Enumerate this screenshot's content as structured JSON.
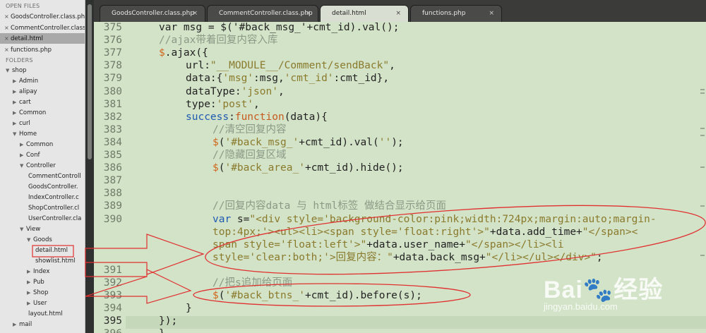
{
  "sidebar": {
    "open_files_heading": "OPEN FILES",
    "open_files": [
      {
        "label": "GoodsController.class.ph",
        "selected": false
      },
      {
        "label": "CommentController.class",
        "selected": false
      },
      {
        "label": "detail.html",
        "selected": true
      },
      {
        "label": "functions.php",
        "selected": false
      }
    ],
    "folders_heading": "FOLDERS",
    "tree": [
      {
        "label": "shop",
        "depth": 0,
        "state": "open"
      },
      {
        "label": "Admin",
        "depth": 1,
        "state": "closed"
      },
      {
        "label": "alipay",
        "depth": 1,
        "state": "closed"
      },
      {
        "label": "cart",
        "depth": 1,
        "state": "closed"
      },
      {
        "label": "Common",
        "depth": 1,
        "state": "closed"
      },
      {
        "label": "curl",
        "depth": 1,
        "state": "closed"
      },
      {
        "label": "Home",
        "depth": 1,
        "state": "open"
      },
      {
        "label": "Common",
        "depth": 2,
        "state": "closed"
      },
      {
        "label": "Conf",
        "depth": 2,
        "state": "closed"
      },
      {
        "label": "Controller",
        "depth": 2,
        "state": "open"
      },
      {
        "label": "CommentControll",
        "depth": 3,
        "state": "file"
      },
      {
        "label": "GoodsController.",
        "depth": 3,
        "state": "file"
      },
      {
        "label": "IndexController.c",
        "depth": 3,
        "state": "file"
      },
      {
        "label": "ShopController.cl",
        "depth": 3,
        "state": "file"
      },
      {
        "label": "UserController.cla",
        "depth": 3,
        "state": "file"
      },
      {
        "label": "View",
        "depth": 2,
        "state": "open"
      },
      {
        "label": "Goods",
        "depth": 3,
        "state": "open"
      },
      {
        "label": "detail.html",
        "depth": 4,
        "state": "file",
        "highlight": true
      },
      {
        "label": "showlist.html",
        "depth": 4,
        "state": "file"
      },
      {
        "label": "Index",
        "depth": 3,
        "state": "closed"
      },
      {
        "label": "Pub",
        "depth": 3,
        "state": "closed"
      },
      {
        "label": "Shop",
        "depth": 3,
        "state": "closed"
      },
      {
        "label": "User",
        "depth": 3,
        "state": "closed"
      },
      {
        "label": "layout.html",
        "depth": 3,
        "state": "file"
      },
      {
        "label": "mail",
        "depth": 1,
        "state": "closed"
      }
    ]
  },
  "tabs": [
    {
      "label": "GoodsController.class.php",
      "active": false
    },
    {
      "label": "CommentController.class.php",
      "active": false
    },
    {
      "label": "detail.html",
      "active": true
    },
    {
      "label": "functions.php",
      "active": false
    }
  ],
  "editor": {
    "current_line": "395",
    "lines": [
      {
        "n": "375",
        "indent": 0,
        "tokens": [
          {
            "t": "var msg = $('#back_msg_'+cmt_id).val();",
            "c": ""
          }
        ]
      },
      {
        "n": "376",
        "indent": 0,
        "tokens": [
          {
            "t": "//ajax带着回复内容入库",
            "c": "cmt"
          }
        ]
      },
      {
        "n": "377",
        "indent": 0,
        "tokens": [
          {
            "t": "$",
            "c": "fnc"
          },
          {
            "t": ".ajax({",
            "c": ""
          }
        ]
      },
      {
        "n": "378",
        "indent": 1,
        "tokens": [
          {
            "t": "url:",
            "c": ""
          },
          {
            "t": "\"__MODULE__/Comment/sendBack\"",
            "c": "str"
          },
          {
            "t": ",",
            "c": ""
          }
        ]
      },
      {
        "n": "379",
        "indent": 1,
        "tokens": [
          {
            "t": "data:{",
            "c": ""
          },
          {
            "t": "'msg'",
            "c": "str"
          },
          {
            "t": ":msg,",
            "c": ""
          },
          {
            "t": "'cmt_id'",
            "c": "str"
          },
          {
            "t": ":cmt_id},",
            "c": ""
          }
        ]
      },
      {
        "n": "380",
        "indent": 1,
        "tokens": [
          {
            "t": "dataType:",
            "c": ""
          },
          {
            "t": "'json'",
            "c": "str"
          },
          {
            "t": ",",
            "c": ""
          }
        ]
      },
      {
        "n": "381",
        "indent": 1,
        "tokens": [
          {
            "t": "type:",
            "c": ""
          },
          {
            "t": "'post'",
            "c": "str"
          },
          {
            "t": ",",
            "c": ""
          }
        ]
      },
      {
        "n": "382",
        "indent": 1,
        "tokens": [
          {
            "t": "success",
            "c": "kw"
          },
          {
            "t": ":",
            "c": ""
          },
          {
            "t": "function",
            "c": "kw2"
          },
          {
            "t": "(data){",
            "c": ""
          }
        ]
      },
      {
        "n": "383",
        "indent": 2,
        "tokens": [
          {
            "t": "//清空回复内容",
            "c": "cmt"
          }
        ]
      },
      {
        "n": "384",
        "indent": 2,
        "tokens": [
          {
            "t": "$",
            "c": "fnc"
          },
          {
            "t": "(",
            "c": ""
          },
          {
            "t": "'#back_msg_'",
            "c": "str"
          },
          {
            "t": "+cmt_id).val(",
            "c": ""
          },
          {
            "t": "''",
            "c": "str"
          },
          {
            "t": ");",
            "c": ""
          }
        ]
      },
      {
        "n": "385",
        "indent": 2,
        "tokens": [
          {
            "t": "//隐藏回复区域",
            "c": "cmt"
          }
        ]
      },
      {
        "n": "386",
        "indent": 2,
        "tokens": [
          {
            "t": "$",
            "c": "fnc"
          },
          {
            "t": "(",
            "c": ""
          },
          {
            "t": "'#back_area_'",
            "c": "str"
          },
          {
            "t": "+cmt_id).hide();",
            "c": ""
          }
        ]
      },
      {
        "n": "387",
        "indent": 0,
        "tokens": []
      },
      {
        "n": "388",
        "indent": 0,
        "tokens": []
      },
      {
        "n": "389",
        "indent": 2,
        "tokens": [
          {
            "t": "//回复内容data 与 html标签 做结合显示给页面",
            "c": "cmt"
          }
        ]
      },
      {
        "n": "390",
        "indent": 2,
        "tokens": [
          {
            "t": "var",
            "c": "kw"
          },
          {
            "t": " s=",
            "c": ""
          },
          {
            "t": "\"<div style='background-color:pink;width:724px;margin:auto;margin-",
            "c": "str"
          }
        ]
      },
      {
        "n": "",
        "indent": 2,
        "tokens": [
          {
            "t": "top:4px;'><ul><li><span style='float:right'>\"",
            "c": "str"
          },
          {
            "t": "+data.add_time+",
            "c": ""
          },
          {
            "t": "\"</span><",
            "c": "str"
          }
        ]
      },
      {
        "n": "",
        "indent": 2,
        "tokens": [
          {
            "t": "span style='float:left'>\"",
            "c": "str"
          },
          {
            "t": "+data.user_name+",
            "c": ""
          },
          {
            "t": "\"</span></li><li",
            "c": "str"
          }
        ]
      },
      {
        "n": "",
        "indent": 2,
        "tokens": [
          {
            "t": "style='clear:both;'>回复内容：\"",
            "c": "str"
          },
          {
            "t": "+data.back_msg+",
            "c": ""
          },
          {
            "t": "\"</li></ul></div>\"",
            "c": "str"
          },
          {
            "t": ";",
            "c": ""
          }
        ]
      },
      {
        "n": "391",
        "indent": 0,
        "tokens": []
      },
      {
        "n": "392",
        "indent": 2,
        "tokens": [
          {
            "t": "//把s追加给页面",
            "c": "cmt"
          }
        ]
      },
      {
        "n": "393",
        "indent": 2,
        "tokens": [
          {
            "t": "$",
            "c": "fnc"
          },
          {
            "t": "(",
            "c": ""
          },
          {
            "t": "'#back_btns_'",
            "c": "str"
          },
          {
            "t": "+cmt_id).before(s);",
            "c": ""
          }
        ]
      },
      {
        "n": "394",
        "indent": 1,
        "tokens": [
          {
            "t": "}",
            "c": ""
          }
        ]
      },
      {
        "n": "395",
        "indent": 0,
        "tokens": [
          {
            "t": "});",
            "c": ""
          }
        ]
      },
      {
        "n": "396",
        "indent": 0,
        "tokens": [
          {
            "t": "}",
            "c": ""
          }
        ]
      }
    ]
  },
  "watermark": {
    "logo": "Bai",
    "logo_suffix": "经验",
    "url": "jingyan.baidu.com"
  },
  "colors": {
    "editor_bg": "#d3e3c8",
    "annotation_red": "#e03030"
  }
}
